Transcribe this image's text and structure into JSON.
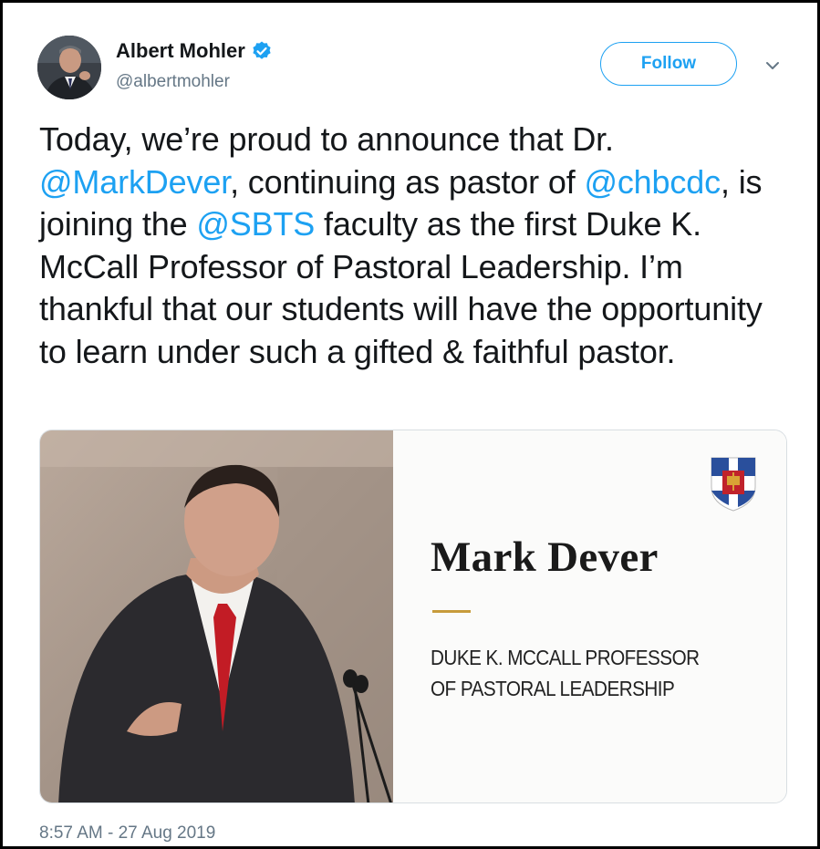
{
  "author": {
    "display_name": "Albert Mohler",
    "handle": "@albertmohler",
    "verified": true,
    "avatar_icon": "user-avatar-photo"
  },
  "actions": {
    "follow_label": "Follow",
    "menu_icon": "chevron-down-icon"
  },
  "tweet": {
    "segments": [
      {
        "text": "Today, we’re proud to announce that Dr. ",
        "mention": false
      },
      {
        "text": "@MarkDever",
        "mention": true
      },
      {
        "text": ", continuing as pastor of ",
        "mention": false
      },
      {
        "text": "@chbcdc",
        "mention": true
      },
      {
        "text": ", is joining the ",
        "mention": false
      },
      {
        "text": "@SBTS",
        "mention": true
      },
      {
        "text": " faculty as the first Duke K. McCall Professor of Pastoral Leadership. I’m thankful that our students will have the opportunity to learn under such a gifted & faithful pastor.",
        "mention": false
      }
    ],
    "timestamp": "8:57 AM - 27 Aug 2019"
  },
  "card": {
    "name": "Mark Dever",
    "title": "DUKE K. MCCALL PROFESSOR OF PASTORAL LEADERSHIP",
    "logo_icon": "seminary-shield-icon",
    "photo_icon": "speaker-photo"
  },
  "colors": {
    "link": "#1da1f2",
    "text": "#14171a",
    "muted": "#657786",
    "accent_rule": "#c79b3b"
  }
}
